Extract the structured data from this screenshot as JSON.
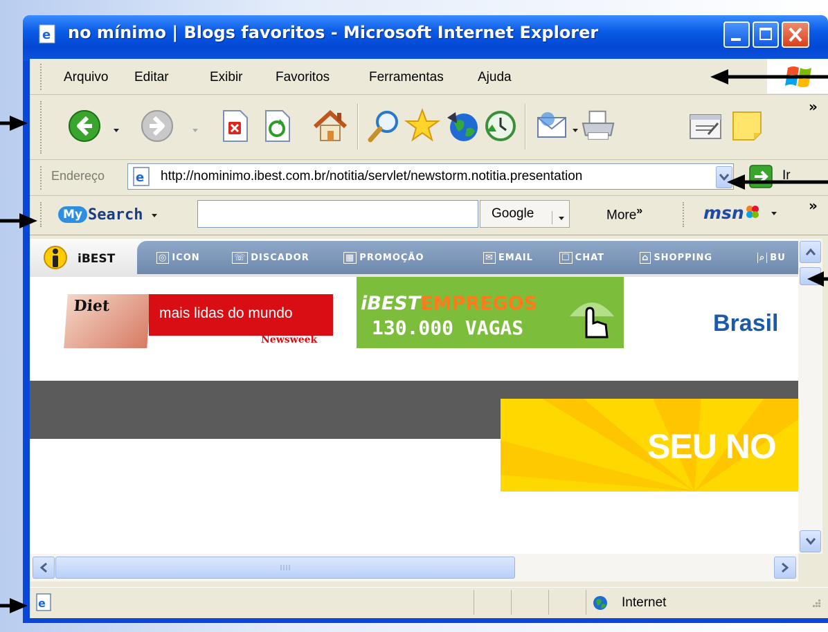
{
  "window": {
    "title": "no mínimo | Blogs favoritos - Microsoft Internet Explorer"
  },
  "menu": {
    "items": [
      "Arquivo",
      "Editar",
      "Exibir",
      "Favoritos",
      "Ferramentas",
      "Ajuda"
    ]
  },
  "toolbar": {
    "buttons": [
      "back-icon",
      "forward-icon",
      "stop-icon",
      "refresh-icon",
      "home-icon",
      "search-icon",
      "favorites-icon",
      "media-icon",
      "history-icon",
      "mail-icon",
      "print-icon",
      "edit-icon",
      "messenger-icon"
    ],
    "more": "»"
  },
  "address": {
    "label": "Endereço",
    "url": "http://nominimo.ibest.com.br/notitia/servlet/newstorm.notitia.presentation",
    "go_label": "Ir"
  },
  "search_toolbar": {
    "brand_my": "My",
    "brand_search": "Search",
    "input_value": "",
    "engine": "Google",
    "more": "More",
    "more_chevron": "»",
    "msn": "msn",
    "overflow": "»"
  },
  "ibest_toolbar": {
    "brand": "iBEST",
    "links": [
      "ICON",
      "DISCADOR",
      "PROMOÇÃO",
      "EMAIL",
      "CHAT",
      "SHOPPING",
      "BU"
    ]
  },
  "page": {
    "banner1_text": "mais lidas do mundo",
    "banner1_brand": "Newsweek",
    "banner1_cover": "Diet",
    "banner2_title_1": "iBEST",
    "banner2_title_2": "EMPREGOS",
    "banner2_sub": "130.000 VAGAS",
    "banner3_text": "Brasil",
    "banner4_text": "SEU NO"
  },
  "status": {
    "zone": "Internet"
  },
  "colors": {
    "title_blue": "#0a52dc",
    "chrome": "#ece9d8",
    "newsweek_red": "#d90e14",
    "empregos_green": "#7cbd3c",
    "brasil_blue": "#1b5aa8",
    "yellow": "#ffd800"
  }
}
